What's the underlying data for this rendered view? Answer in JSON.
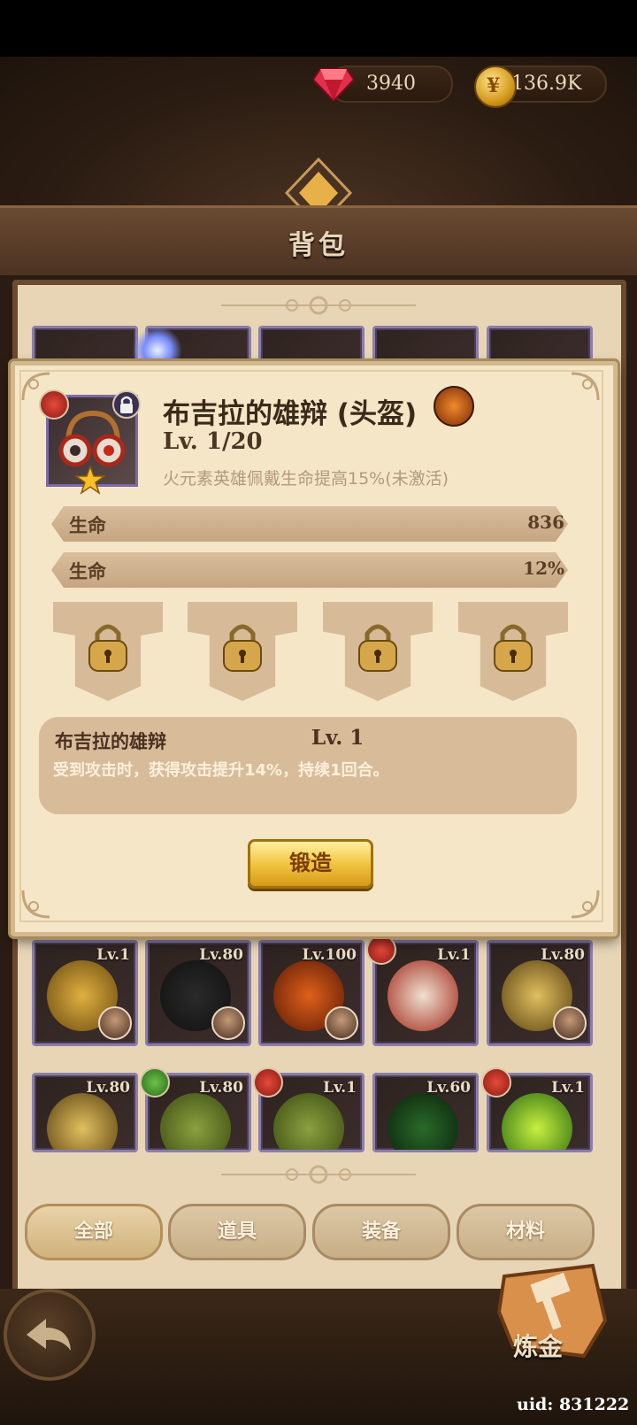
{
  "header": {
    "gems": "3940",
    "gold": "136.9K",
    "title": "背包"
  },
  "popup": {
    "item_name": "布吉拉的雄辩 (头盔)",
    "level": "Lv. 1/20",
    "set_bonus": "火元素英雄佩戴生命提高15%(未激活)",
    "stats": [
      {
        "label": "生命",
        "value": "836"
      },
      {
        "label": "生命",
        "value": "12%"
      }
    ],
    "skill": {
      "name": "布吉拉的雄辩",
      "level": "Lv. 1",
      "description": "受到攻击时，获得攻击提升14%，持续1回合。"
    },
    "forge_label": "锻造"
  },
  "inventory": {
    "row1": [
      "Lv.1",
      "Lv.80",
      "Lv.100",
      "Lv.1",
      "Lv.80"
    ],
    "row2": [
      "Lv.80",
      "Lv.80",
      "Lv.1",
      "Lv.60",
      "Lv.1"
    ]
  },
  "tabs": [
    "全部",
    "道具",
    "装备",
    "材料"
  ],
  "footer": {
    "alchemy_label": "炼金",
    "uid": "uid: 831222"
  },
  "colors": {
    "panel": "#e7d5b6",
    "popup": "#f5e6c8",
    "forge_button": "#f2c541",
    "epic_frame": "#8c7ea8"
  }
}
